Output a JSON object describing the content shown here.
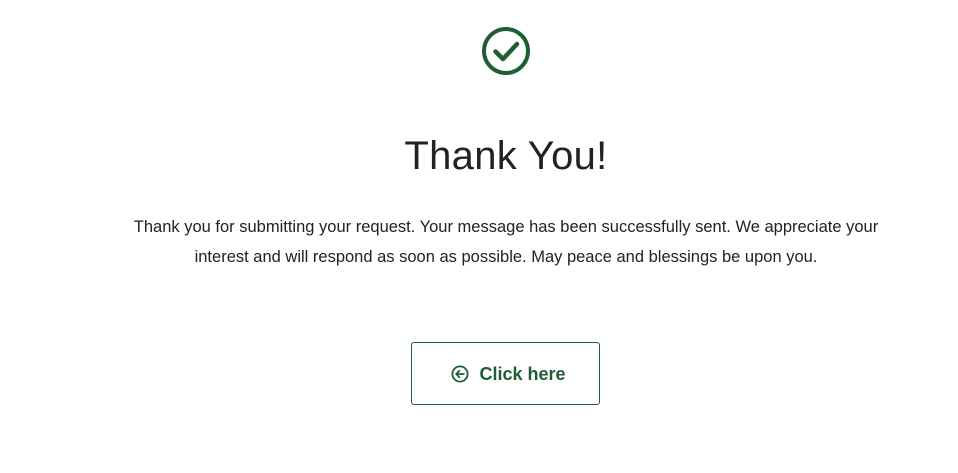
{
  "confirmation": {
    "icon": "check-circle-icon",
    "title": "Thank You!",
    "message": "Thank you for submitting your request. Your message has been successfully sent. We appreciate your interest and will respond as soon as possible. May peace and blessings be upon you."
  },
  "cta": {
    "label": "Click here",
    "icon": "arrow-left-circle-icon"
  },
  "colors": {
    "accent": "#1d5e34",
    "text": "#222222",
    "background": "#ffffff"
  }
}
